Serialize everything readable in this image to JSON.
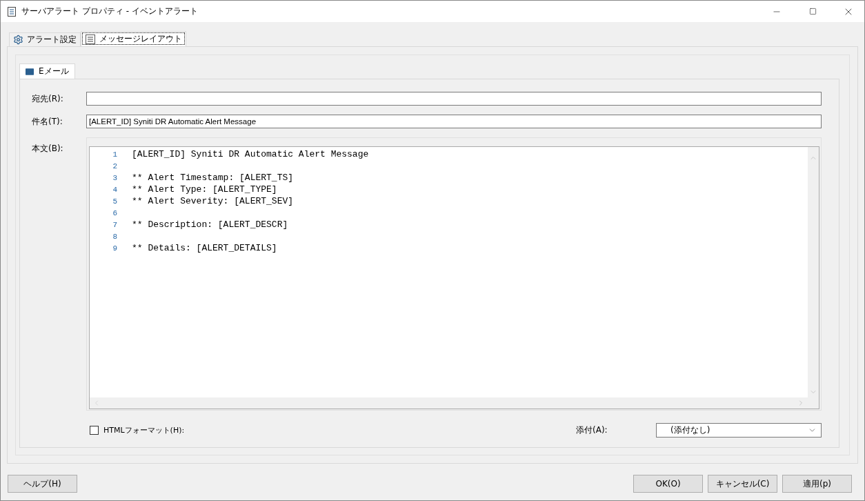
{
  "window": {
    "title": "サーバアラート プロパティ - イベントアラート"
  },
  "tabs": [
    {
      "label": "アラート設定",
      "selected": false
    },
    {
      "label": "メッセージレイアウト",
      "selected": true
    }
  ],
  "sub_tabs": [
    {
      "label": "Eメール",
      "selected": true
    }
  ],
  "fields": [
    {
      "label": "宛先(R):"
    },
    {
      "label": "件名(T):",
      "value": "[ALERT_ID] Syniti DR Automatic Alert Message"
    }
  ],
  "body": {
    "label": "本文(B):",
    "lines": [
      {
        "number": "1",
        "text": "[ALERT_ID] Syniti DR Automatic Alert Message"
      },
      {
        "number": "2"
      },
      {
        "number": "3",
        "text": "** Alert Timestamp: [ALERT_TS]"
      },
      {
        "number": "4",
        "text": "** Alert Type: [ALERT_TYPE]"
      },
      {
        "number": "5",
        "text": "** Alert Severity: [ALERT_SEV]"
      },
      {
        "number": "6"
      },
      {
        "number": "7",
        "text": "** Description: [ALERT_DESCR]"
      },
      {
        "number": "8"
      },
      {
        "number": "9",
        "text": "** Details: [ALERT_DETAILS]"
      }
    ]
  },
  "html_format": {
    "label": "HTMLフォーマット(H):",
    "checked": false
  },
  "attachment": {
    "label": "添付(A):",
    "value": "(添付なし)"
  },
  "buttons": [
    {
      "label": "ヘルプ(H)"
    },
    {
      "label": "OK(O)"
    },
    {
      "label": "キャンセル(C)"
    },
    {
      "label": "適用(p)"
    }
  ]
}
